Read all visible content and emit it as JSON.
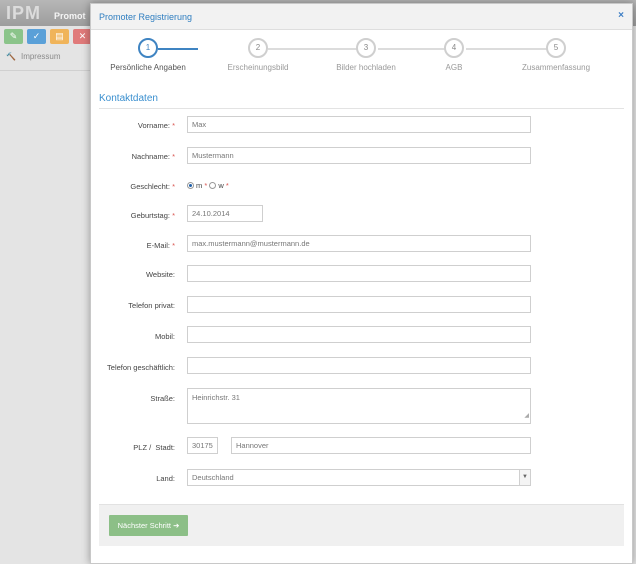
{
  "background": {
    "logo": "IPM",
    "logo_sub": "Promot",
    "toolbar_icons": [
      "edit-icon",
      "check-icon",
      "document-icon",
      "close-icon"
    ],
    "toolbar_colors": [
      "#8bc48a",
      "#5aa0d8",
      "#f0b45a",
      "#e07a7a"
    ],
    "sidebar_item": "Impressum"
  },
  "modal": {
    "title": "Promoter Registrierung",
    "close": "×"
  },
  "steps": [
    {
      "num": "1",
      "label": "Persönliche Angaben",
      "active": true
    },
    {
      "num": "2",
      "label": "Erscheinungsbild",
      "active": false
    },
    {
      "num": "3",
      "label": "Bilder hochladen",
      "active": false
    },
    {
      "num": "4",
      "label": "AGB",
      "active": false
    },
    {
      "num": "5",
      "label": "Zusammenfassung",
      "active": false
    }
  ],
  "section_title": "Kontaktdaten",
  "form": {
    "vorname_label": "Vorname:",
    "vorname_value": "Max",
    "nachname_label": "Nachname:",
    "nachname_value": "Mustermann",
    "geschlecht_label": "Geschlecht:",
    "geschlecht_m": "m",
    "geschlecht_w": "w",
    "geburtstag_label": "Geburtstag:",
    "geburtstag_value": "24.10.2014",
    "email_label": "E-Mail:",
    "email_value": "max.mustermann@mustermann.de",
    "website_label": "Website:",
    "telefon_privat_label": "Telefon privat:",
    "mobil_label": "Mobil:",
    "telefon_geschaeftlich_label": "Telefon geschäftlich:",
    "strasse_label": "Straße:",
    "strasse_value": "Heinrichstr. 31",
    "plz_label": "PLZ /",
    "stadt_label": "Stadt:",
    "plz_value": "30175",
    "stadt_value": "Hannover",
    "land_label": "Land:",
    "land_value": "Deutschland",
    "required_mark": "*"
  },
  "footer": {
    "next_button": "Nächster Schritt ➔"
  }
}
